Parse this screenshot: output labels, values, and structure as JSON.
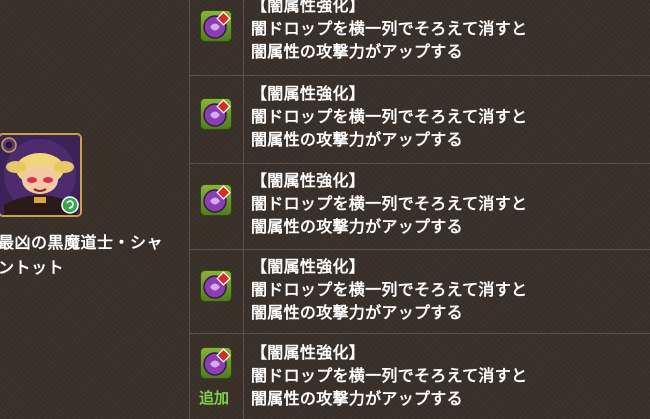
{
  "monster": {
    "name": "最凶の黒魔道士・シャ\nントット",
    "icon": "shantotto-dark-mage-portrait-icon",
    "colors": {
      "frame": "#c6a24a",
      "badge": "#3aa64a"
    }
  },
  "skills": [
    {
      "icon": "dark-enhanced-attack-awakening-icon",
      "title": "【闇属性強化】",
      "line1": "闇ドロップを横一列でそろえて消すと",
      "line2": "闇属性の攻撃力がアップする",
      "added": ""
    },
    {
      "icon": "dark-enhanced-attack-awakening-icon",
      "title": "【闇属性強化】",
      "line1": "闇ドロップを横一列でそろえて消すと",
      "line2": "闇属性の攻撃力がアップする",
      "added": ""
    },
    {
      "icon": "dark-enhanced-attack-awakening-icon",
      "title": "【闇属性強化】",
      "line1": "闇ドロップを横一列でそろえて消すと",
      "line2": "闇属性の攻撃力がアップする",
      "added": ""
    },
    {
      "icon": "dark-enhanced-attack-awakening-icon",
      "title": "【闇属性強化】",
      "line1": "闇ドロップを横一列でそろえて消すと",
      "line2": "闇属性の攻撃力がアップする",
      "added": ""
    },
    {
      "icon": "dark-enhanced-attack-awakening-icon",
      "title": "【闇属性強化】",
      "line1": "闇ドロップを横一列でそろえて消すと",
      "line2": "闇属性の攻撃力がアップする",
      "added": "追加"
    }
  ],
  "colors": {
    "background": "#3a302a",
    "divider": "#5d524a",
    "text": "#ffffff",
    "added": "#7fd14a",
    "icon_green": "#6f9e2a",
    "icon_purple": "#8a3fb0",
    "icon_red": "#d42a2a"
  }
}
